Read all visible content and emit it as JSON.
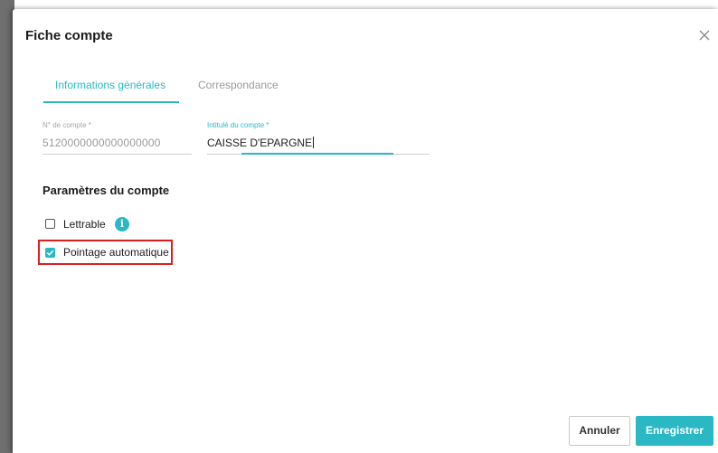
{
  "dialog": {
    "title": "Fiche compte",
    "close_icon": "close-icon"
  },
  "tabs": [
    {
      "label": "Informations générales",
      "active": true
    },
    {
      "label": "Correspondance",
      "active": false
    }
  ],
  "fields": {
    "account_number": {
      "label": "N° de compte *",
      "value": "5120000000000000000"
    },
    "account_title": {
      "label": "Intitulé du compte *",
      "value": "CAISSE D'EPARGNE"
    }
  },
  "settings": {
    "title": "Paramètres du compte",
    "lettrable": {
      "label": "Lettrable",
      "checked": false,
      "info_icon": "info-icon"
    },
    "pointage": {
      "label": "Pointage automatique",
      "checked": true
    }
  },
  "buttons": {
    "cancel": "Annuler",
    "save": "Enregistrer"
  },
  "colors": {
    "accent": "#2ab8c5",
    "highlight": "#e01c1c"
  }
}
